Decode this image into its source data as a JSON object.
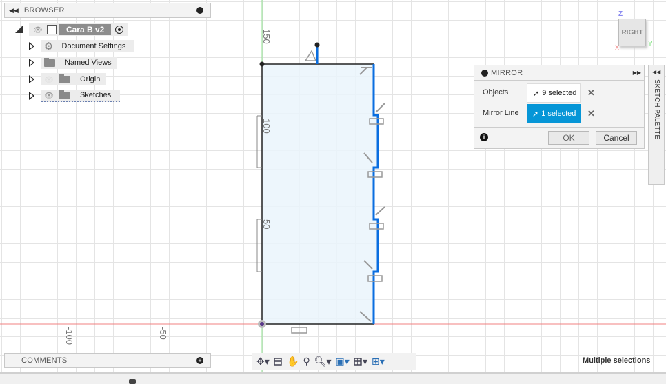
{
  "browser": {
    "title": "BROWSER",
    "root": "Cara B v2",
    "items": [
      {
        "label": "Document Settings",
        "icon": "gear-icon"
      },
      {
        "label": "Named Views",
        "icon": "folder-icon"
      },
      {
        "label": "Origin",
        "icon": "folder-icon"
      },
      {
        "label": "Sketches",
        "icon": "folder-icon"
      }
    ]
  },
  "comments": {
    "title": "COMMENTS"
  },
  "mirror": {
    "title": "MIRROR",
    "objects_label": "Objects",
    "objects_value": "9 selected",
    "mirror_line_label": "Mirror Line",
    "mirror_line_value": "1 selected",
    "ok": "OK",
    "cancel": "Cancel",
    "accent": "#0696d7"
  },
  "sketch_palette": {
    "title": "SKETCH PALETTE"
  },
  "viewcube": {
    "face": "RIGHT",
    "axis_z": "Z",
    "axis_x": "X",
    "axis_y": "Y"
  },
  "rulers": {
    "v": [
      "150",
      "100",
      "50"
    ],
    "h": [
      "-100",
      "-50"
    ]
  },
  "status": {
    "text": "Multiple selections"
  }
}
